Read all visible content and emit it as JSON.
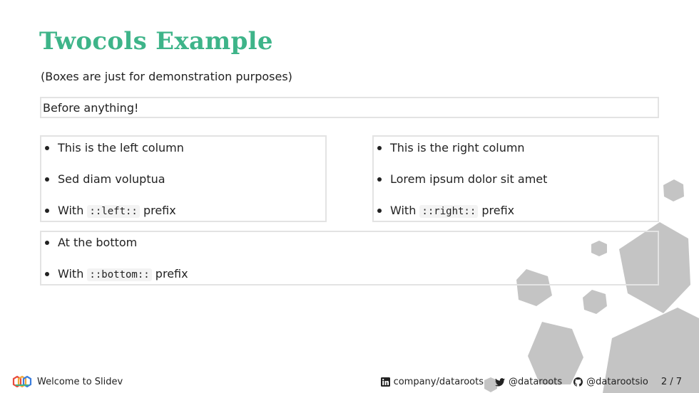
{
  "slide": {
    "title": "Twocols Example",
    "subtitle": "(Boxes are just for demonstration purposes)",
    "top_box_text": "Before anything!",
    "left_items": [
      "This is the left column",
      "Sed diam voluptua",
      {
        "prefix": "With ",
        "code": "::left::",
        "suffix": " prefix"
      }
    ],
    "right_items": [
      "This is the right column",
      "Lorem ipsum dolor sit amet",
      {
        "prefix": "With ",
        "code": "::right::",
        "suffix": " prefix"
      }
    ],
    "bottom_items": [
      "At the bottom",
      {
        "prefix": "With ",
        "code": "::bottom::",
        "suffix": " prefix"
      }
    ]
  },
  "footer": {
    "presentation_title": "Welcome to Slidev",
    "linkedin": "company/dataroots",
    "twitter": "@dataroots",
    "github": "@datarootsio",
    "page_number": "2 / 7",
    "icons": [
      "dataroots-logo-icon",
      "linkedin-icon",
      "twitter-icon",
      "github-icon"
    ]
  },
  "colors": {
    "title": "#3eb489",
    "hexagons": "#c4c4c4",
    "box_border": "#e3e3e3"
  }
}
